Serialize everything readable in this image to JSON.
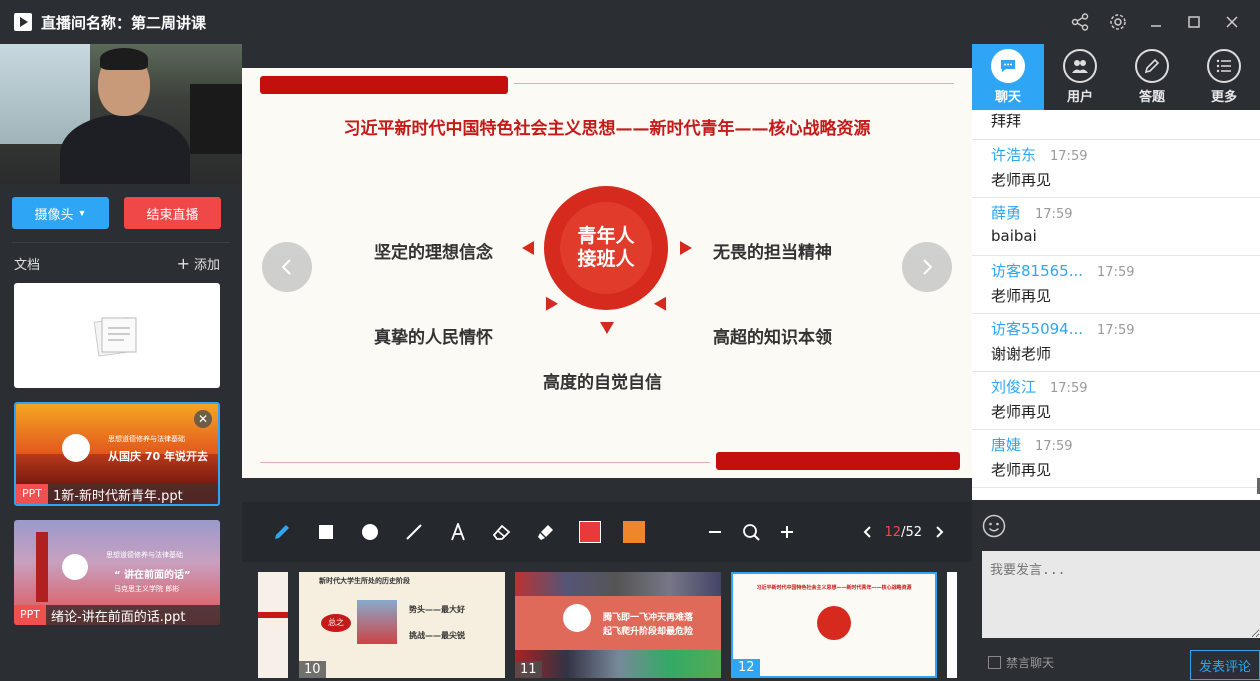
{
  "window": {
    "title": "直播间名称：第二周讲课"
  },
  "left": {
    "camera_button": "摄像头",
    "end_button": "结束直播",
    "docs_label": "文档",
    "add_label": "添加",
    "docs": [
      {
        "tag": "PPT",
        "name": "1新-新时代新青年.ppt",
        "thumb_title": "从国庆 70 年说开去",
        "thumb_sub": "思想道德修养与法律基础"
      },
      {
        "tag": "PPT",
        "name": "绪论-讲在前面的话.ppt",
        "thumb_title": "“ 讲在前面的话”",
        "thumb_sub": "思想道德修养与法律基础",
        "thumb_author": "马克思主义学院 郎彬"
      }
    ]
  },
  "slide": {
    "title": "习近平新时代中国特色社会主义思想——新时代青年——核心战略资源",
    "center_line1": "青年人",
    "center_line2": "接班人",
    "items": {
      "top_left": "坚定的理想信念",
      "top_right": "无畏的担当精神",
      "bottom_left": "真挚的人民情怀",
      "bottom_right": "高超的知识本领",
      "bottom": "高度的自觉自信"
    }
  },
  "toolbar": {
    "pen_color": "#e83a3a",
    "fill_color": "#f0862c",
    "page_current": "12",
    "page_total": "/52"
  },
  "thumbs": [
    {
      "num": "10",
      "title": "新时代大学生所处的历史阶段",
      "line1": "势头——最大好",
      "line2": "挑战——最尖锐",
      "badge": "总之"
    },
    {
      "num": "11",
      "line1": "腾飞即一飞冲天再难落",
      "line2": "起飞爬升阶段却最危险"
    },
    {
      "num": "12",
      "title": "习近平新时代中国特色社会主义思想——新时代青年——核心战略资源"
    }
  ],
  "tabs": [
    {
      "label": "聊天",
      "icon": "chat-bubble-icon"
    },
    {
      "label": "用户",
      "icon": "users-icon"
    },
    {
      "label": "答题",
      "icon": "pencil-icon"
    },
    {
      "label": "更多",
      "icon": "list-icon"
    }
  ],
  "chat": {
    "first_partial": "拜拜",
    "messages": [
      {
        "name": "许浩东",
        "time": "17:59",
        "text": "老师再见"
      },
      {
        "name": "薛勇",
        "time": "17:59",
        "text": "baibai"
      },
      {
        "name": "访客81565...",
        "time": "17:59",
        "text": "老师再见"
      },
      {
        "name": "访客55094...",
        "time": "17:59",
        "text": "谢谢老师"
      },
      {
        "name": "刘俊江",
        "time": "17:59",
        "text": "老师再见"
      },
      {
        "name": "唐婕",
        "time": "17:59",
        "text": "老师再见"
      }
    ]
  },
  "composer": {
    "placeholder": "我要发言...",
    "mute_label": "禁言聊天",
    "send_label": "发表评论"
  }
}
